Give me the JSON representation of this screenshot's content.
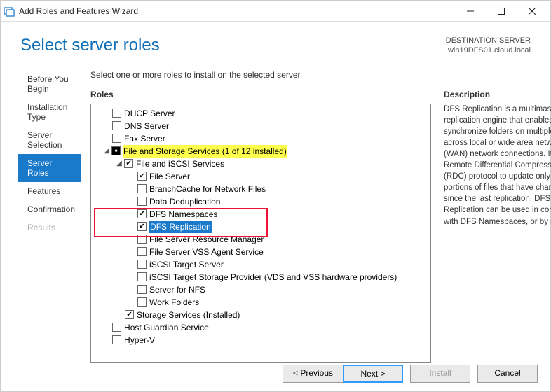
{
  "window": {
    "title": "Add Roles and Features Wizard"
  },
  "header": {
    "title": "Select server roles",
    "dest_label": "DESTINATION SERVER",
    "dest_server": "win19DFS01.cloud.local"
  },
  "sidebar": {
    "items": [
      {
        "label": "Before You Begin"
      },
      {
        "label": "Installation Type"
      },
      {
        "label": "Server Selection"
      },
      {
        "label": "Server Roles"
      },
      {
        "label": "Features"
      },
      {
        "label": "Confirmation"
      },
      {
        "label": "Results"
      }
    ]
  },
  "main": {
    "instruction": "Select one or more roles to install on the selected server.",
    "roles_label": "Roles",
    "description_label": "Description",
    "description_text": "DFS Replication is a multimaster replication engine that enables you to synchronize folders on multiple servers across local or wide area network (WAN) network connections. It uses the Remote Differential Compression (RDC) protocol to update only the portions of files that have changed since the last replication. DFS Replication can be used in conjunction with DFS Namespaces, or by itself."
  },
  "roles": {
    "r0": "DHCP Server",
    "r1": "DNS Server",
    "r2": "Fax Server",
    "r3": "File and Storage Services (1 of 12 installed)",
    "r4": "File and iSCSI Services",
    "r5": "File Server",
    "r6": "BranchCache for Network Files",
    "r7": "Data Deduplication",
    "r8": "DFS Namespaces",
    "r9": "DFS Replication",
    "r10": "File Server Resource Manager",
    "r11": "File Server VSS Agent Service",
    "r12": "iSCSI Target Server",
    "r13": "iSCSI Target Storage Provider (VDS and VSS hardware providers)",
    "r14": "Server for NFS",
    "r15": "Work Folders",
    "r16": "Storage Services (Installed)",
    "r17": "Host Guardian Service",
    "r18": "Hyper-V"
  },
  "footer": {
    "previous": "< Previous",
    "next": "Next >",
    "install": "Install",
    "cancel": "Cancel"
  }
}
